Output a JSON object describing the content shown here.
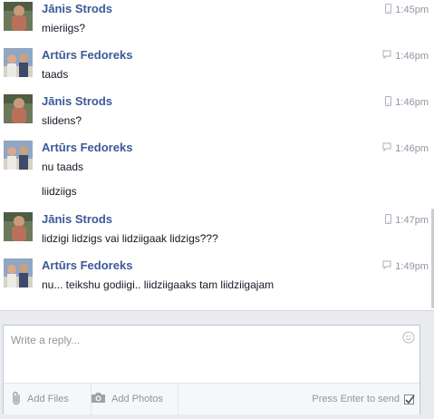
{
  "messages": [
    {
      "sender": "Jānis Strods",
      "time": "1:45pm",
      "via": "mobile-icon",
      "lines": [
        "mieriigs?"
      ]
    },
    {
      "sender": "Artūrs Fedoreks",
      "time": "1:46pm",
      "via": "chat-icon",
      "lines": [
        "taads"
      ]
    },
    {
      "sender": "Jānis Strods",
      "time": "1:46pm",
      "via": "mobile-icon",
      "lines": [
        "slidens?"
      ]
    },
    {
      "sender": "Artūrs Fedoreks",
      "time": "1:46pm",
      "via": "chat-icon",
      "lines": [
        "nu taads",
        "liidziigs"
      ]
    },
    {
      "sender": "Jānis Strods",
      "time": "1:47pm",
      "via": "mobile-icon",
      "lines": [
        "lidzigi lidzigs vai lidziigaak lidzigs???"
      ]
    },
    {
      "sender": "Artūrs Fedoreks",
      "time": "1:49pm",
      "via": "chat-icon",
      "lines": [
        "nu... teikshu godiigi.. liidziigaaks tam liidziigajam"
      ]
    }
  ],
  "composer": {
    "placeholder": "Write a reply...",
    "add_files_label": "Add Files",
    "add_photos_label": "Add Photos",
    "press_enter_label": "Press Enter to send",
    "press_enter_checked": true
  },
  "colors": {
    "sender_name": "#3b5998",
    "timestamp": "#9197a3",
    "composer_bg": "#e9ebee"
  }
}
